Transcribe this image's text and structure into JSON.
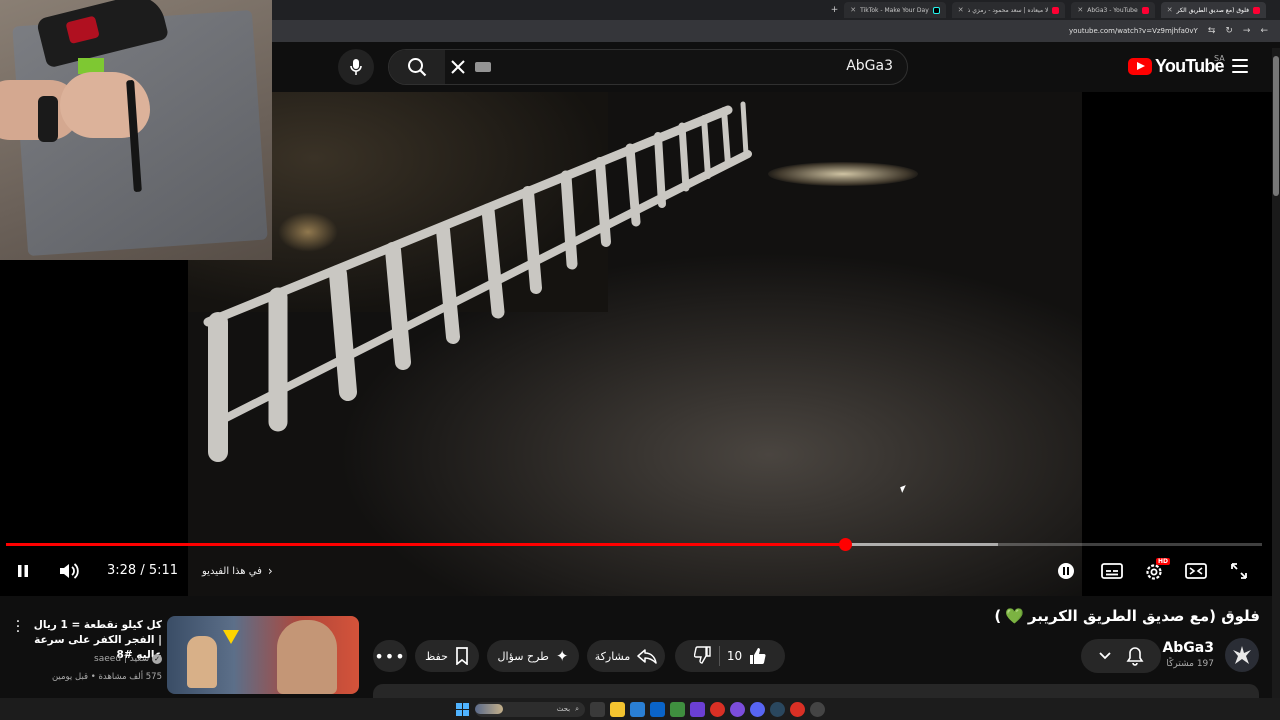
{
  "browser": {
    "tabs": [
      {
        "label": "فلوق (مع صديق الطريق الكر",
        "active": true
      },
      {
        "label": "AbGa3 - YouTube",
        "active": false
      },
      {
        "label": "لا ميعاده | سعد محمود - رمزي ذ",
        "active": false
      },
      {
        "label": "TikTok - Make Your Day",
        "active": false
      }
    ],
    "new_tab": "+",
    "url": "youtube.com/watch?v=Vz9mjhfa0vY"
  },
  "youtube": {
    "logo_text": "YouTube",
    "country_code": "SA",
    "search_query": "AbGa3"
  },
  "player": {
    "current_time": "3:28",
    "duration": "5:11",
    "time_display": "3:28 / 5:11",
    "progress_fraction": 0.668,
    "buffered_fraction": 0.79,
    "chapter_label": "في هذا الفيديو",
    "quality_badge": "HD"
  },
  "video": {
    "title": "فلوق (مع صديق الطريق الكريبر",
    "title_emoji": "💚",
    "title_close": ")",
    "channel_name": "AbGa3",
    "subscribers": "197 مشتركًا",
    "likes": "10",
    "share_label": "مشاركة",
    "ask_label": "طرح سؤال",
    "save_label": "حفظ",
    "more_label": "•••"
  },
  "recommendation": {
    "title": "كل كيلو نقطعة = 1 ريال | الفجر الكفر على سرعة عاليه #8",
    "channel": "سعيد | saeed",
    "views": "575 ألف مشاهدة",
    "age": "قبل يومين",
    "meta": "575 ألف مشاهدة • قبل يومين"
  },
  "taskbar": {
    "search_placeholder": "بحث"
  },
  "colors": {
    "accent": "#ff0000",
    "background": "#0f0f0f",
    "pill": "#272727",
    "like_heart": "#2ecc71"
  }
}
